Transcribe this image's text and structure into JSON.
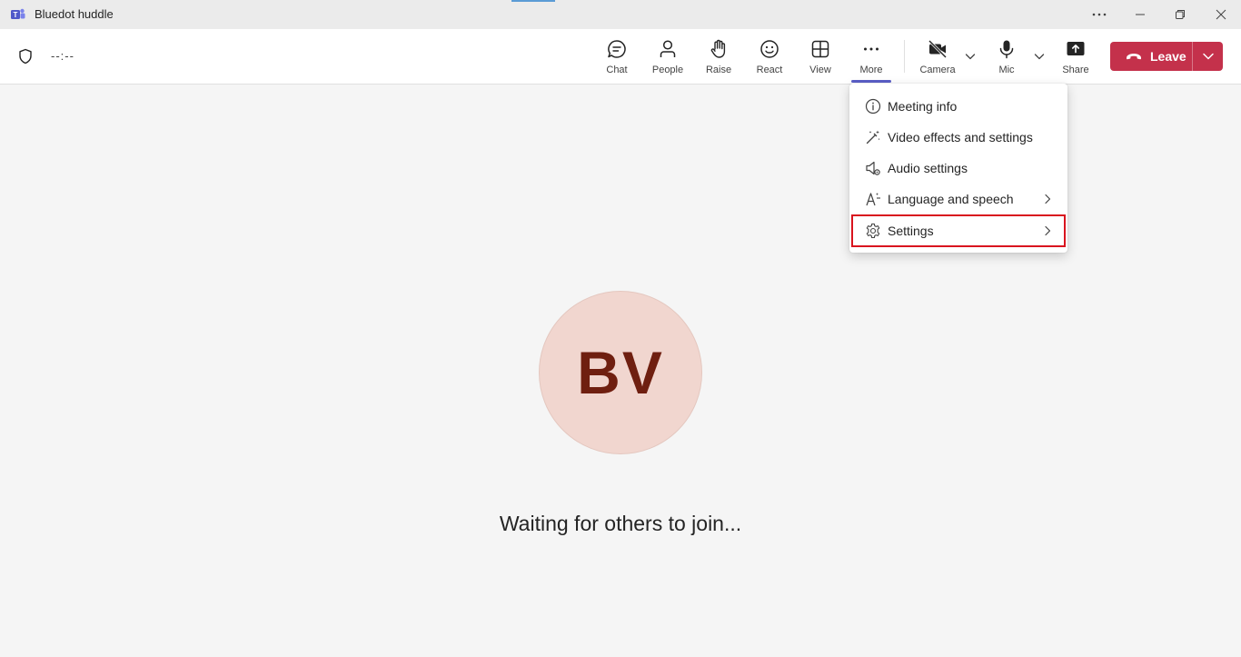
{
  "window": {
    "title": "Bluedot huddle",
    "controls": [
      "more-options",
      "minimize",
      "restore",
      "close"
    ]
  },
  "toolbar": {
    "timer": "--:--",
    "buttons": {
      "chat": "Chat",
      "people": "People",
      "raise": "Raise",
      "react": "React",
      "view": "View",
      "more": "More",
      "camera": "Camera",
      "mic": "Mic",
      "share": "Share"
    },
    "leave_label": "Leave",
    "leave_color": "#c4314b",
    "active_accent": "#5b5fc7"
  },
  "more_menu": {
    "items": [
      {
        "label": "Meeting info",
        "icon": "info-icon",
        "submenu": false
      },
      {
        "label": "Video effects and settings",
        "icon": "magic-wand-icon",
        "submenu": false
      },
      {
        "label": "Audio settings",
        "icon": "speaker-gear-icon",
        "submenu": false
      },
      {
        "label": "Language and speech",
        "icon": "language-icon",
        "submenu": true
      },
      {
        "label": "Settings",
        "icon": "gear-icon",
        "submenu": true,
        "highlighted": true
      }
    ],
    "highlight_color": "#d9141e"
  },
  "main": {
    "avatar_initials": "BV",
    "avatar_bg": "#f1d6cf",
    "avatar_fg": "#6f1f10",
    "waiting_text": "Waiting for others to join..."
  }
}
